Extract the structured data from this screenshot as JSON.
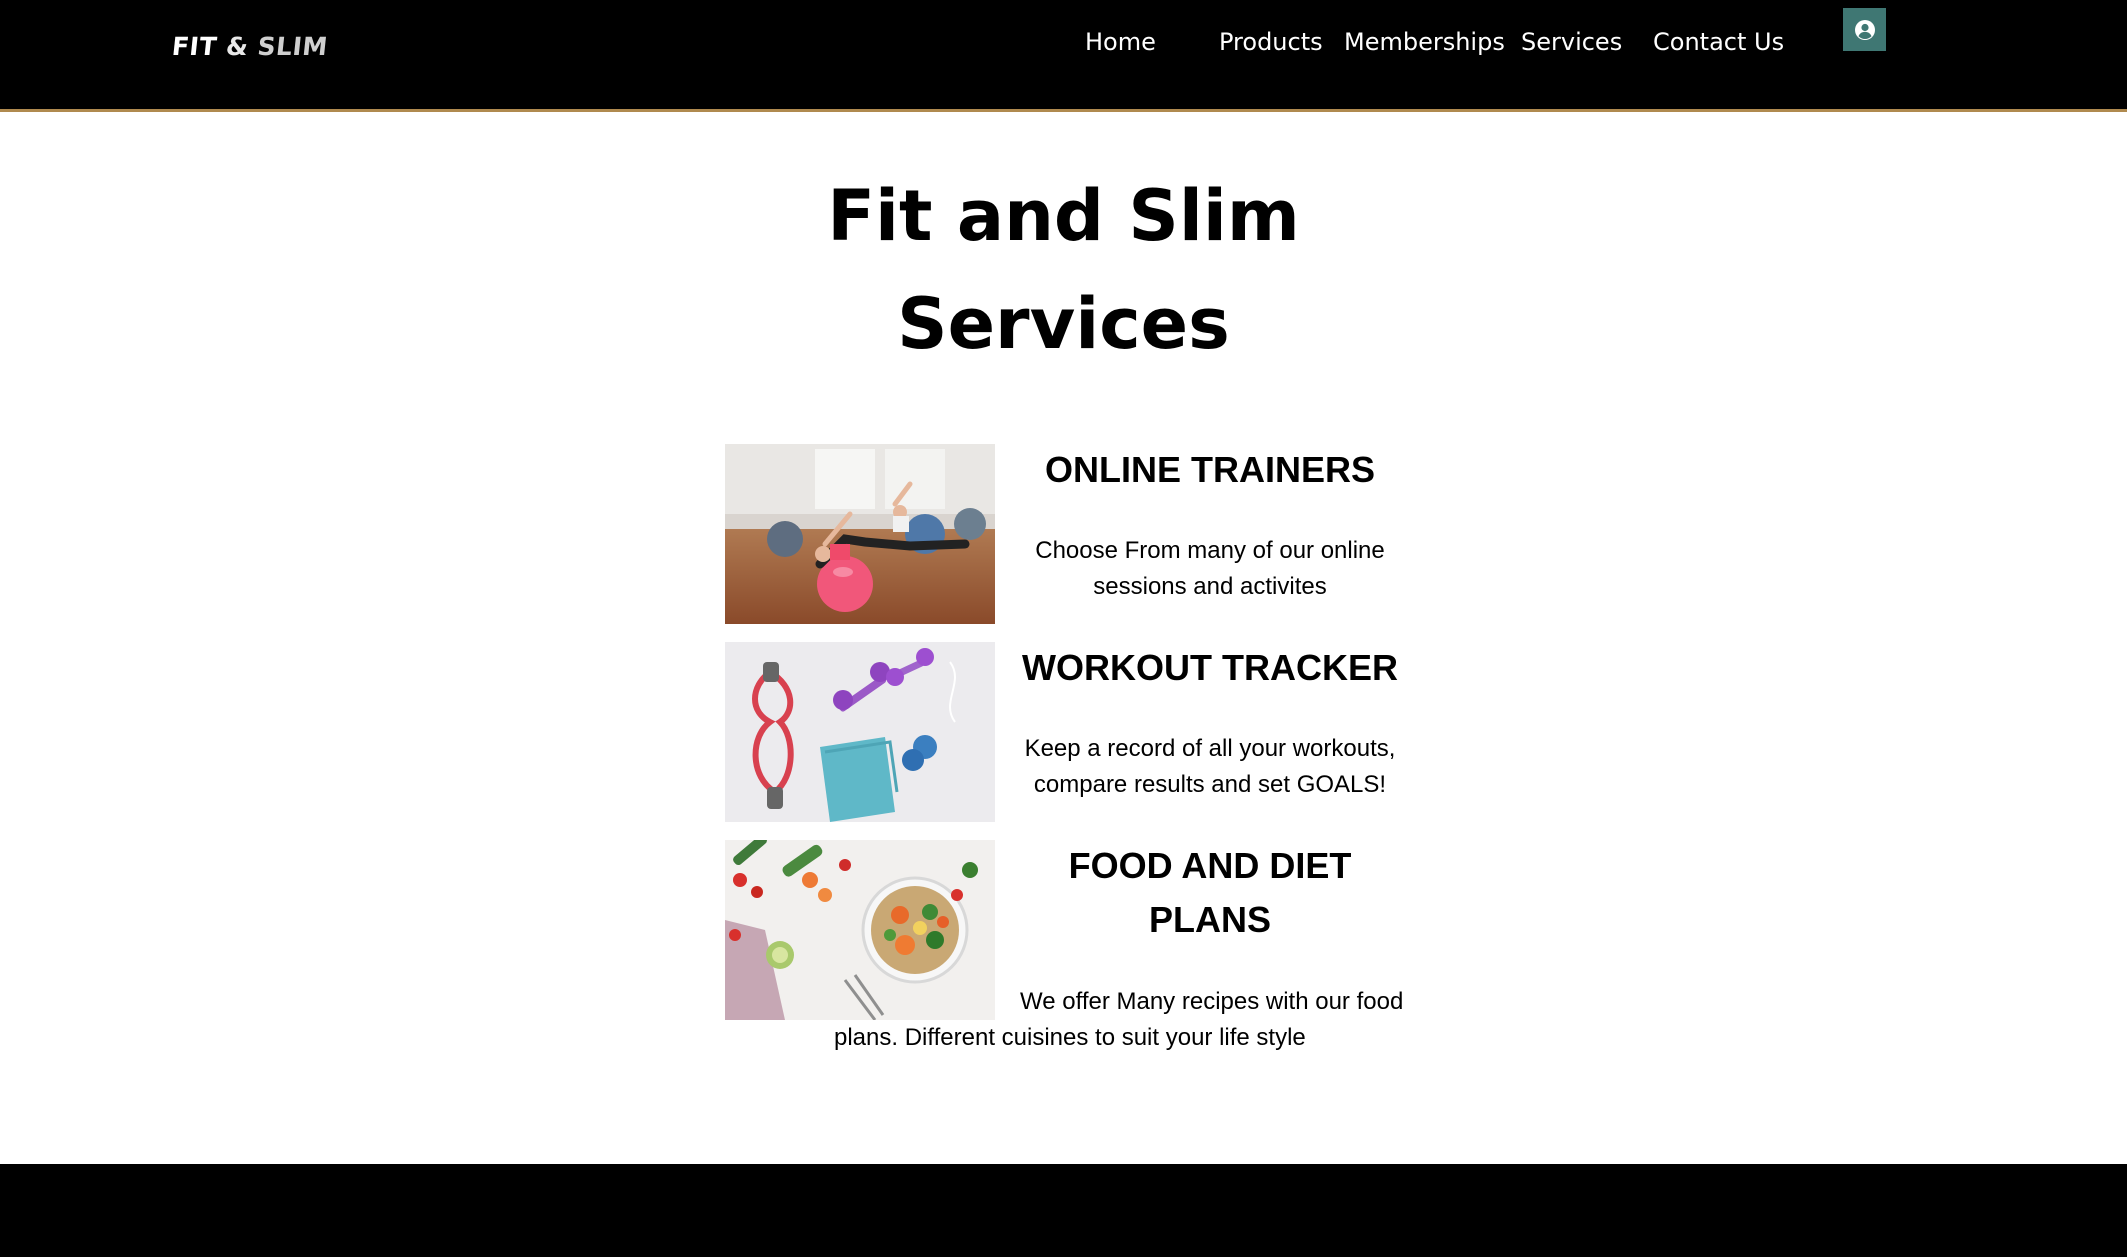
{
  "header": {
    "logo": {
      "part1": "FIT",
      "amp": "&",
      "part2": "SLIM"
    },
    "nav": [
      {
        "label": "Home"
      },
      {
        "label": "Products"
      },
      {
        "label": "Memberships"
      },
      {
        "label": "Services"
      },
      {
        "label": "Contact Us"
      }
    ],
    "login_icon": "user-circle-icon",
    "accent_color": "#3f7773",
    "border_color": "#b08a4f"
  },
  "main": {
    "title_line1": "Fit and Slim",
    "title_line2": "Services",
    "services": [
      {
        "heading": "ONLINE TRAINERS",
        "desc_line1": "Choose From many of our online",
        "desc_line2": "sessions and activites",
        "image": "fitness-class-image"
      },
      {
        "heading": "WORKOUT TRACKER",
        "desc_line1": "Keep a record of all your workouts,",
        "desc_line2": "compare results and set GOALS!",
        "image": "workout-equipment-image"
      },
      {
        "heading_line1": "FOOD AND DIET",
        "heading_line2": "PLANS",
        "desc_line1": "We offer Many recipes with our food",
        "desc_line2": "plans. Different cuisines to suit your life style",
        "image": "healthy-food-image"
      }
    ]
  }
}
